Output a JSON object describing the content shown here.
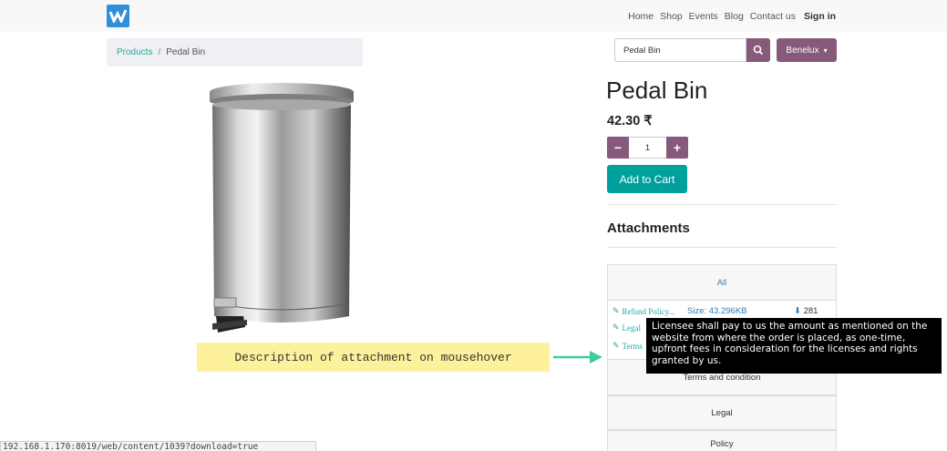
{
  "nav": {
    "items": [
      "Home",
      "Shop",
      "Events",
      "Blog",
      "Contact us"
    ],
    "sign_in": "Sign in"
  },
  "breadcrumb": {
    "parent": "Products",
    "separator": "/",
    "current": "Pedal Bin"
  },
  "search": {
    "value": "Pedal Bin"
  },
  "pricelist": {
    "label": "Benelux",
    "caret": "▾"
  },
  "product": {
    "name": "Pedal Bin",
    "price": "42.30 ₹",
    "quantity": "1",
    "add_to_cart": "Add to Cart"
  },
  "attachments": {
    "heading": "Attachments",
    "all_label": "All",
    "rows": [
      {
        "name": "Refund Policy...",
        "size": "Size: 43.296KB",
        "downloads": "281"
      },
      {
        "name": "Legal"
      },
      {
        "name": "Terms"
      }
    ],
    "groups": [
      "Terms and condition",
      "Legal",
      "Policy"
    ]
  },
  "tooltip": {
    "text": "Licensee shall pay to us the amount as mentioned on the website from where the order is placed, as one-time, upfront fees in consideration for the licenses and rights granted by us."
  },
  "callout": {
    "text": "Description of attachment on mousehover"
  },
  "statusbar": {
    "url": "192.168.1.170:8019/web/content/1039?download=true"
  },
  "colors": {
    "primary": "#875a7b",
    "teal": "#00a09d",
    "logo": "#2f8fd8",
    "callout_bg": "#fdf19b",
    "arrow": "#3ecf9b"
  },
  "icons": {
    "search": "search-icon",
    "clip": "paperclip-icon",
    "download": "download-icon"
  }
}
